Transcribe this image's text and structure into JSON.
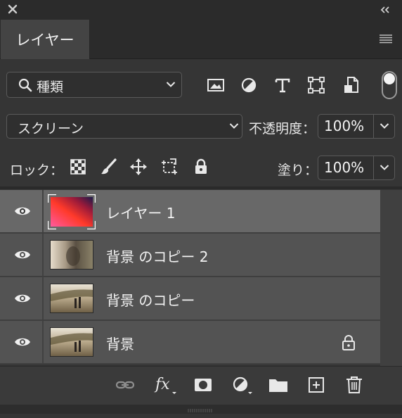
{
  "window": {
    "close_icon": "close-icon",
    "collapse_icon": "double-chevron-left-icon"
  },
  "tab": {
    "label": "レイヤー",
    "menu_icon": "hamburger-menu-icon"
  },
  "filter": {
    "kind_label": "種類",
    "icons": [
      "image-filter-icon",
      "adjustment-filter-icon",
      "type-filter-icon",
      "shape-filter-icon",
      "smart-object-filter-icon"
    ]
  },
  "blend": {
    "mode": "スクリーン",
    "opacity_label": "不透明度：",
    "opacity_value": "100%"
  },
  "lock": {
    "label": "ロック：",
    "icons": [
      "lock-transparent-pixels-icon",
      "lock-image-pixels-icon",
      "lock-position-icon",
      "lock-artboard-icon",
      "lock-all-icon"
    ],
    "fill_label": "塗り：",
    "fill_value": "100%"
  },
  "layers": [
    {
      "name": "レイヤー 1",
      "selected": true,
      "locked": false,
      "thumb": "red-gradient"
    },
    {
      "name": "背景 のコピー 2",
      "selected": false,
      "locked": false,
      "thumb": "blurred-photo"
    },
    {
      "name": "背景 のコピー",
      "selected": false,
      "locked": false,
      "thumb": "photo"
    },
    {
      "name": "背景",
      "selected": false,
      "locked": true,
      "thumb": "photo"
    }
  ],
  "bottom_toolbar": [
    "link-layers-icon",
    "fx-icon",
    "mask-icon",
    "adjustment-layer-icon",
    "folder-icon",
    "new-layer-icon",
    "trash-icon"
  ],
  "colors": {
    "panel": "#353535",
    "selected_row": "#686868",
    "row": "#535353"
  }
}
